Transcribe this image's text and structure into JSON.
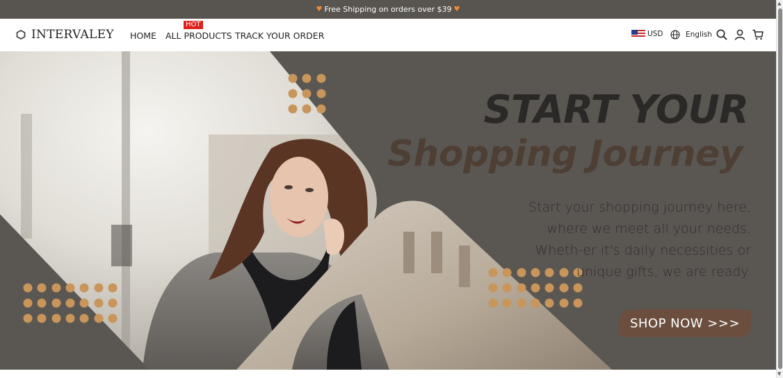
{
  "announcement": {
    "text": "Free Shipping on orders over $39"
  },
  "brand": {
    "name": "INTERVALEY"
  },
  "nav": {
    "home": "HOME",
    "all_products": "ALL PRODUCTS",
    "track_order": "TRACK YOUR ORDER",
    "hot_badge": "HOT"
  },
  "header": {
    "currency": "USD",
    "language": "English"
  },
  "hero": {
    "title_line1": "START YOUR",
    "title_line2": "Shopping Journey",
    "description": "Start your shopping journey here, where we meet all your needs. Wheth-er it's daily necessities or unique gifts, we are ready.",
    "cta": "SHOP NOW >>>"
  },
  "colors": {
    "accent": "#c8955a",
    "hero_bg": "#5a5753",
    "cta_bg": "#6b4e3e",
    "hot_badge": "#e0201b"
  }
}
